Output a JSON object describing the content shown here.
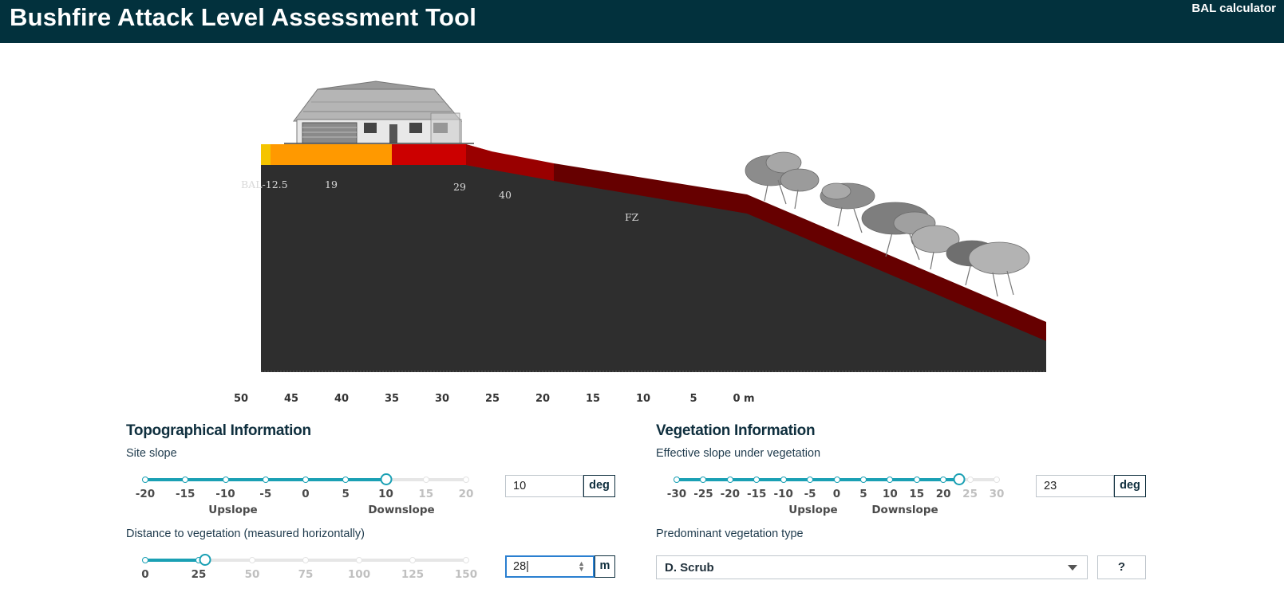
{
  "header": {
    "title": "Bushfire Attack Level Assessment Tool",
    "subtitle": "BAL calculator"
  },
  "scene": {
    "zone_labels": [
      "BAL-12.5",
      "19",
      "29",
      "40",
      "FZ"
    ],
    "distance_axis": [
      "50",
      "45",
      "40",
      "35",
      "30",
      "25",
      "20",
      "15",
      "10",
      "5",
      "0 m"
    ],
    "zone_colors": {
      "bal_12_5": "#f5c400",
      "bal_19": "#ff9900",
      "bal_29": "#cc0000",
      "bal_40": "#990000",
      "fz": "#660000",
      "ground": "#2e2e2e"
    }
  },
  "topo": {
    "title": "Topographical Information",
    "site_slope": {
      "label": "Site slope",
      "ticks": [
        "-20",
        "-15",
        "-10",
        "-5",
        "0",
        "5",
        "10",
        "15",
        "20"
      ],
      "min": -20,
      "max": 20,
      "value_num": 10,
      "upslope": "Upslope",
      "downslope": "Downslope",
      "value": "10",
      "unit": "deg"
    },
    "distance": {
      "label": "Distance to vegetation (measured horizontally)",
      "ticks": [
        "0",
        "25",
        "50",
        "75",
        "100",
        "125",
        "150"
      ],
      "min": 0,
      "max": 150,
      "value_num": 28,
      "value": "28",
      "unit": "m"
    }
  },
  "veg": {
    "title": "Vegetation Information",
    "eff_slope": {
      "label": "Effective slope under vegetation",
      "ticks": [
        "-30",
        "-25",
        "-20",
        "-15",
        "-10",
        "-5",
        "0",
        "5",
        "10",
        "15",
        "20",
        "25",
        "30"
      ],
      "min": -30,
      "max": 30,
      "value_num": 23,
      "upslope": "Upslope",
      "downslope": "Downslope",
      "value": "23",
      "unit": "deg"
    },
    "type": {
      "label": "Predominant vegetation type",
      "selected": "D. Scrub",
      "help": "?"
    }
  },
  "colors": {
    "accent": "#1aa0b4",
    "header_bg": "#02313d"
  }
}
